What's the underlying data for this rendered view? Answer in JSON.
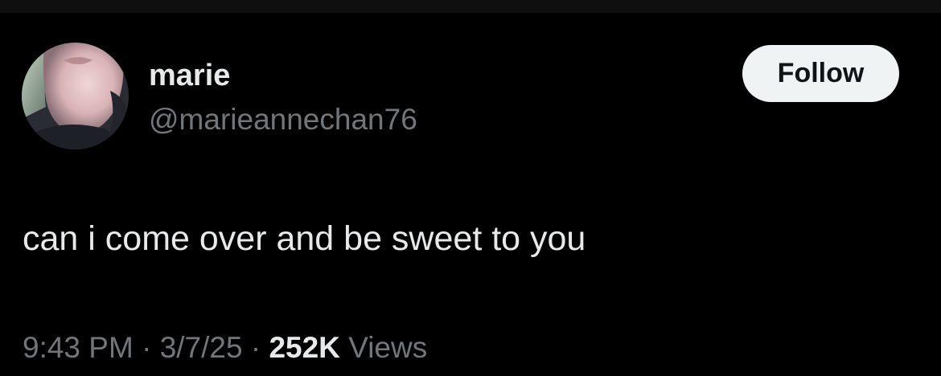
{
  "tweet": {
    "author": {
      "name": "marie",
      "handle": "@marieannechan76"
    },
    "follow_label": "Follow",
    "text": "can i come over and be sweet to you",
    "time": "9:43 PM",
    "separator": "·",
    "date": "3/7/25",
    "views_count": "252K",
    "views_label": "Views"
  },
  "icons": {
    "avatar": "profile-photo"
  },
  "colors": {
    "background": "#000000",
    "primary_text": "#e7e9ea",
    "secondary_text": "#71767b",
    "follow_button_bg": "#eff3f4",
    "follow_button_text": "#0f1419"
  }
}
